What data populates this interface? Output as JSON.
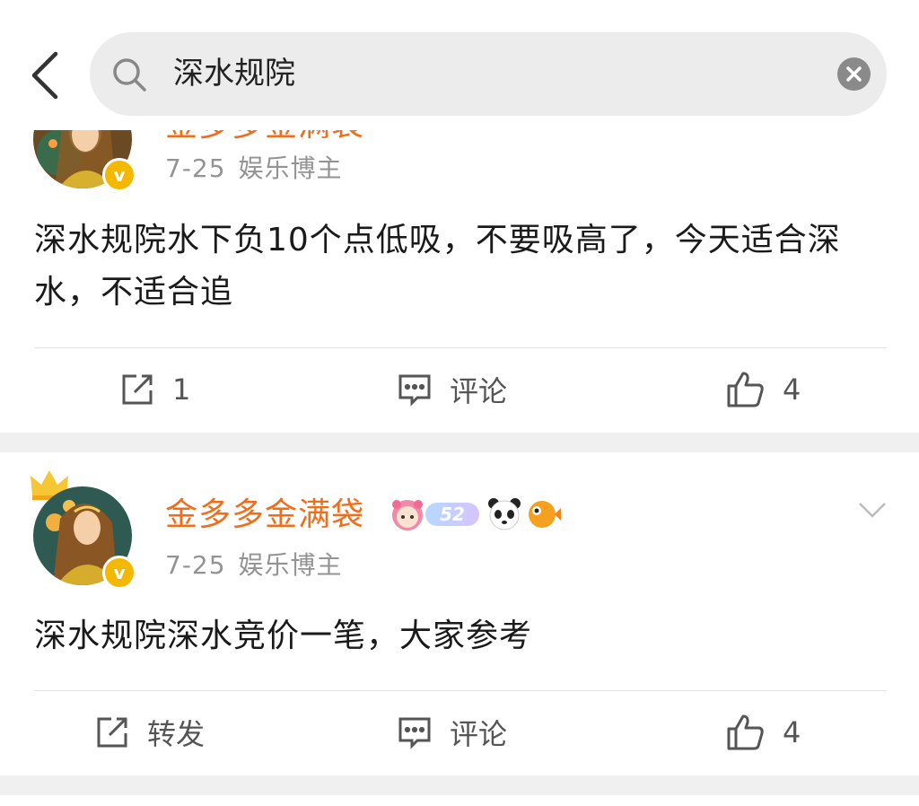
{
  "search": {
    "query": "深水规院"
  },
  "posts": [
    {
      "author": "金多多金满袋",
      "date": "7-25",
      "tag": "娱乐博主",
      "content": "深水规院水下负10个点低吸，不要吸高了，今天适合深水，不适合追",
      "actions": {
        "repost": "1",
        "comment": "评论",
        "like": "4"
      }
    },
    {
      "author": "金多多金满袋",
      "badge_number": "52",
      "date": "7-25",
      "tag": "娱乐博主",
      "content": "深水规院深水竞价一笔，大家参考",
      "actions": {
        "repost": "转发",
        "comment": "评论",
        "like": "4"
      }
    }
  ],
  "colors": {
    "name": "#f26d1a",
    "badge": "#f5b800",
    "separator": "#f0f0f0"
  }
}
